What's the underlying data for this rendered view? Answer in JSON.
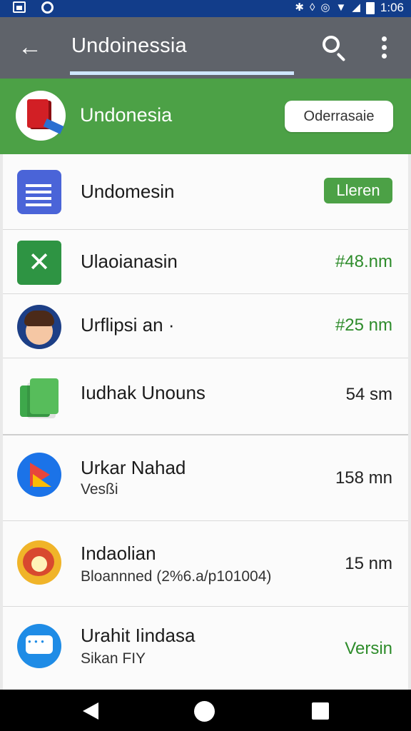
{
  "status_bar": {
    "time": "1:06",
    "icons": [
      "gallery-icon",
      "app-circle-icon",
      "bluetooth-icon",
      "vibrate-icon",
      "alarm-icon",
      "wifi-icon",
      "signal-icon",
      "battery-icon"
    ]
  },
  "app_bar": {
    "back_icon": "←",
    "title": "Undoinessia",
    "search_icon": "search-icon",
    "more_icon": "more-vert-icon"
  },
  "banner": {
    "title": "Undonesia",
    "button_label": "Oderrasaie"
  },
  "rows": [
    {
      "name": "Undomesin",
      "sub": "",
      "value": "Lleren",
      "kind": "pill",
      "icon": "document-icon"
    },
    {
      "name": "Ulaoianasin",
      "sub": "",
      "value": "#48.nm",
      "kind": "green",
      "icon": "spreadsheet-icon"
    },
    {
      "name": "Urflipsi an  ·",
      "sub": "",
      "value": "#25 nm",
      "kind": "green",
      "icon": "avatar-icon"
    },
    {
      "name": "Iudhak Unouns",
      "sub": "",
      "value": "54 sm",
      "kind": "plain",
      "icon": "files-icon"
    },
    {
      "name": "Urkar Nahad",
      "sub": "Vesßi",
      "value": "158 mn",
      "kind": "plain",
      "icon": "play-icon"
    },
    {
      "name": "Indaolian",
      "sub": "Bloannned (2%6.a/p101004)",
      "value": "15 nm",
      "kind": "plain",
      "icon": "map-icon"
    },
    {
      "name": "Urahit Iindasa",
      "sub": "Sikan FIY",
      "value": "Versin",
      "kind": "green",
      "icon": "chat-icon"
    }
  ],
  "nav_bar": {
    "back": "back-icon",
    "home": "home-icon",
    "recents": "recents-icon"
  },
  "colors": {
    "status_bar": "#123d8a",
    "app_bar": "#5f636a",
    "accent_green": "#4ca146",
    "value_green": "#2e8c2b"
  }
}
